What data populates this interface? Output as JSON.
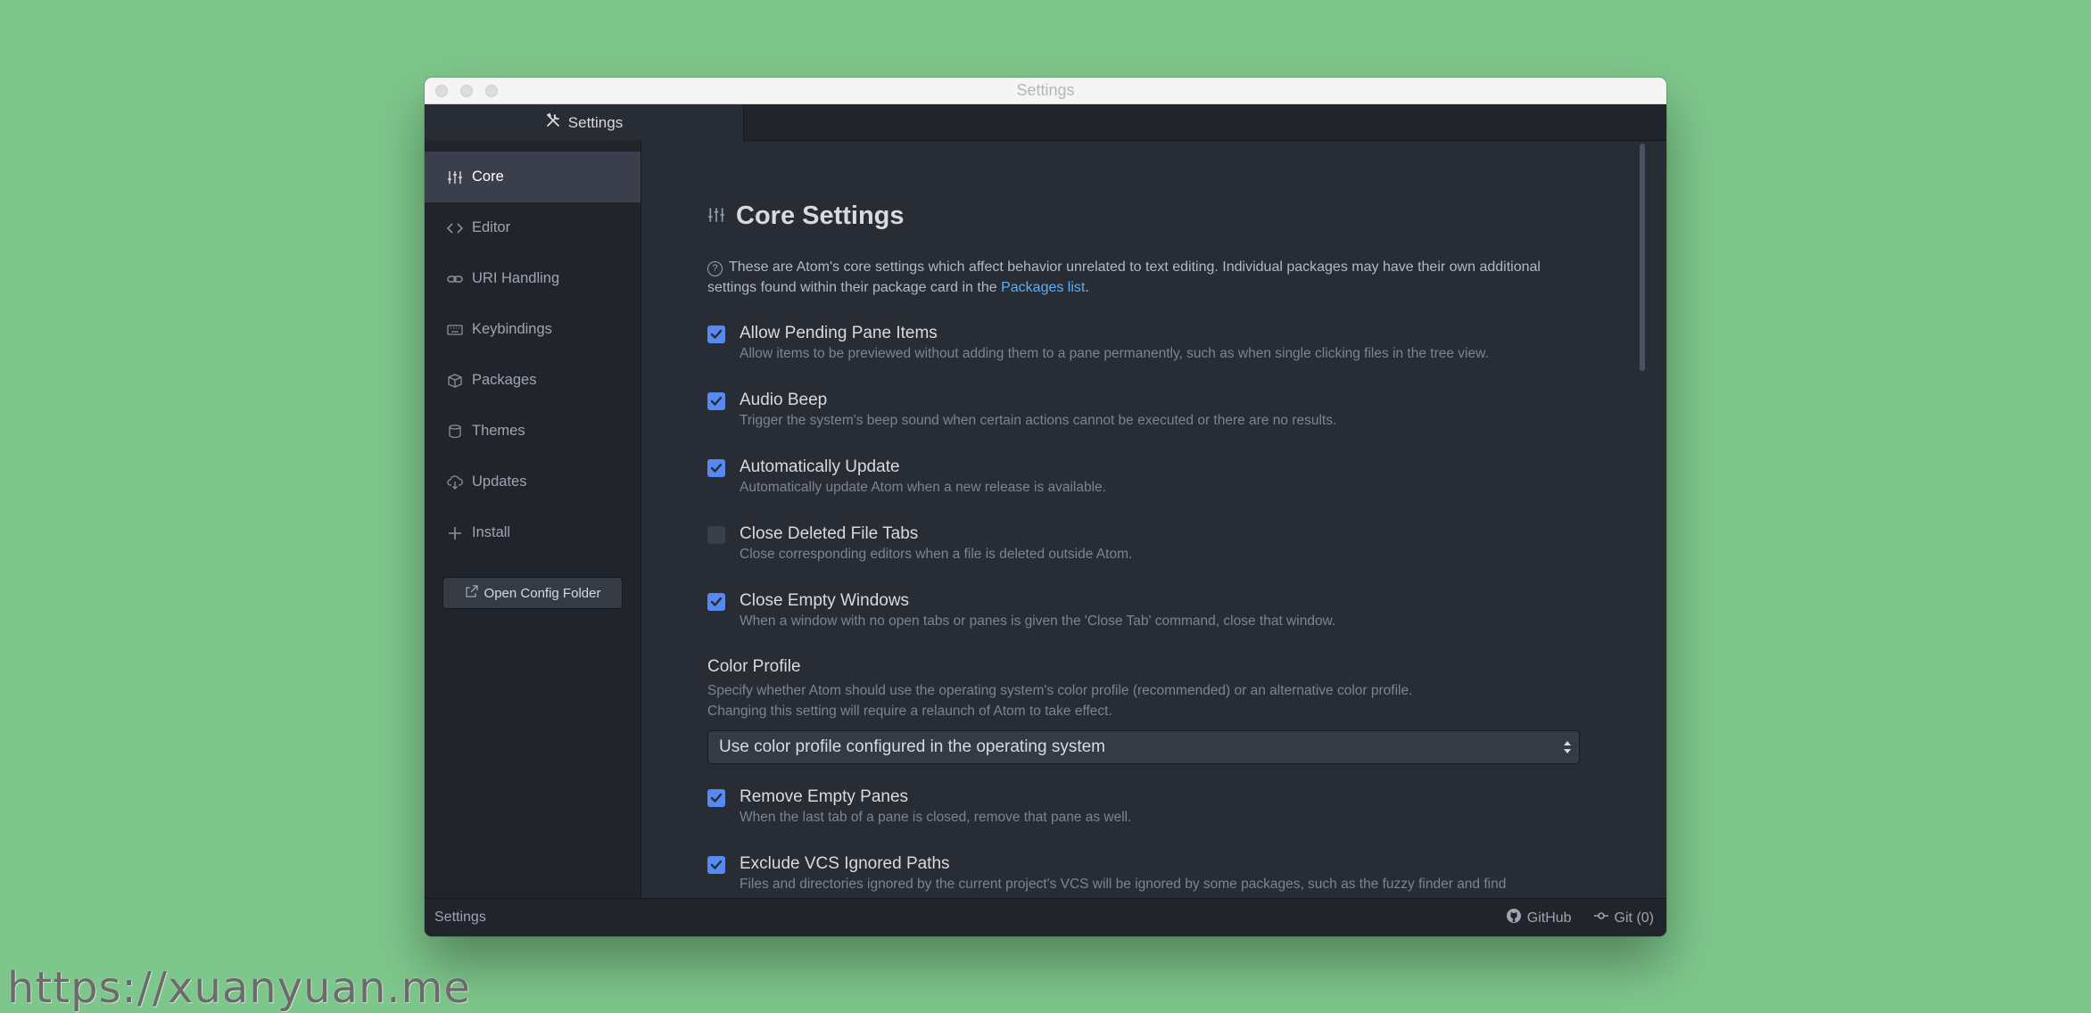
{
  "window": {
    "title": "Settings"
  },
  "tab": {
    "label": "Settings"
  },
  "sidebar": {
    "items": [
      {
        "label": "Core",
        "icon": "sliders-icon"
      },
      {
        "label": "Editor",
        "icon": "code-icon"
      },
      {
        "label": "URI Handling",
        "icon": "link-icon"
      },
      {
        "label": "Keybindings",
        "icon": "keyboard-icon"
      },
      {
        "label": "Packages",
        "icon": "package-icon"
      },
      {
        "label": "Themes",
        "icon": "paintcan-icon"
      },
      {
        "label": "Updates",
        "icon": "cloud-download-icon"
      },
      {
        "label": "Install",
        "icon": "plus-icon"
      }
    ],
    "open_config_label": "Open Config Folder"
  },
  "main": {
    "heading": "Core Settings",
    "intro_text": "These are Atom's core settings which affect behavior unrelated to text editing. Individual packages may have their own additional settings found within their package card in the ",
    "intro_link": "Packages list",
    "intro_end": ".",
    "settings": [
      {
        "title": "Allow Pending Pane Items",
        "desc": "Allow items to be previewed without adding them to a pane permanently, such as when single clicking files in the tree view.",
        "checked": true
      },
      {
        "title": "Audio Beep",
        "desc": "Trigger the system's beep sound when certain actions cannot be executed or there are no results.",
        "checked": true
      },
      {
        "title": "Automatically Update",
        "desc": "Automatically update Atom when a new release is available.",
        "checked": true
      },
      {
        "title": "Close Deleted File Tabs",
        "desc": "Close corresponding editors when a file is deleted outside Atom.",
        "checked": false
      },
      {
        "title": "Close Empty Windows",
        "desc": "When a window with no open tabs or panes is given the 'Close Tab' command, close that window.",
        "checked": true
      },
      {
        "title": "Remove Empty Panes",
        "desc": "When the last tab of a pane is closed, remove that pane as well.",
        "checked": true
      },
      {
        "title": "Exclude VCS Ignored Paths",
        "desc": "Files and directories ignored by the current project's VCS will be ignored by some packages, such as the fuzzy finder and find",
        "checked": true
      }
    ],
    "color_profile": {
      "title": "Color Profile",
      "desc1": "Specify whether Atom should use the operating system's color profile (recommended) or an alternative color profile.",
      "desc2": "Changing this setting will require a relaunch of Atom to take effect.",
      "selected": "Use color profile configured in the operating system"
    }
  },
  "statusbar": {
    "left": "Settings",
    "github": "GitHub",
    "git": "Git (0)"
  },
  "watermark": "https://xuanyuan.me",
  "colors": {
    "background": "#7ec78c",
    "accent": "#568af2",
    "link": "#61afef"
  }
}
